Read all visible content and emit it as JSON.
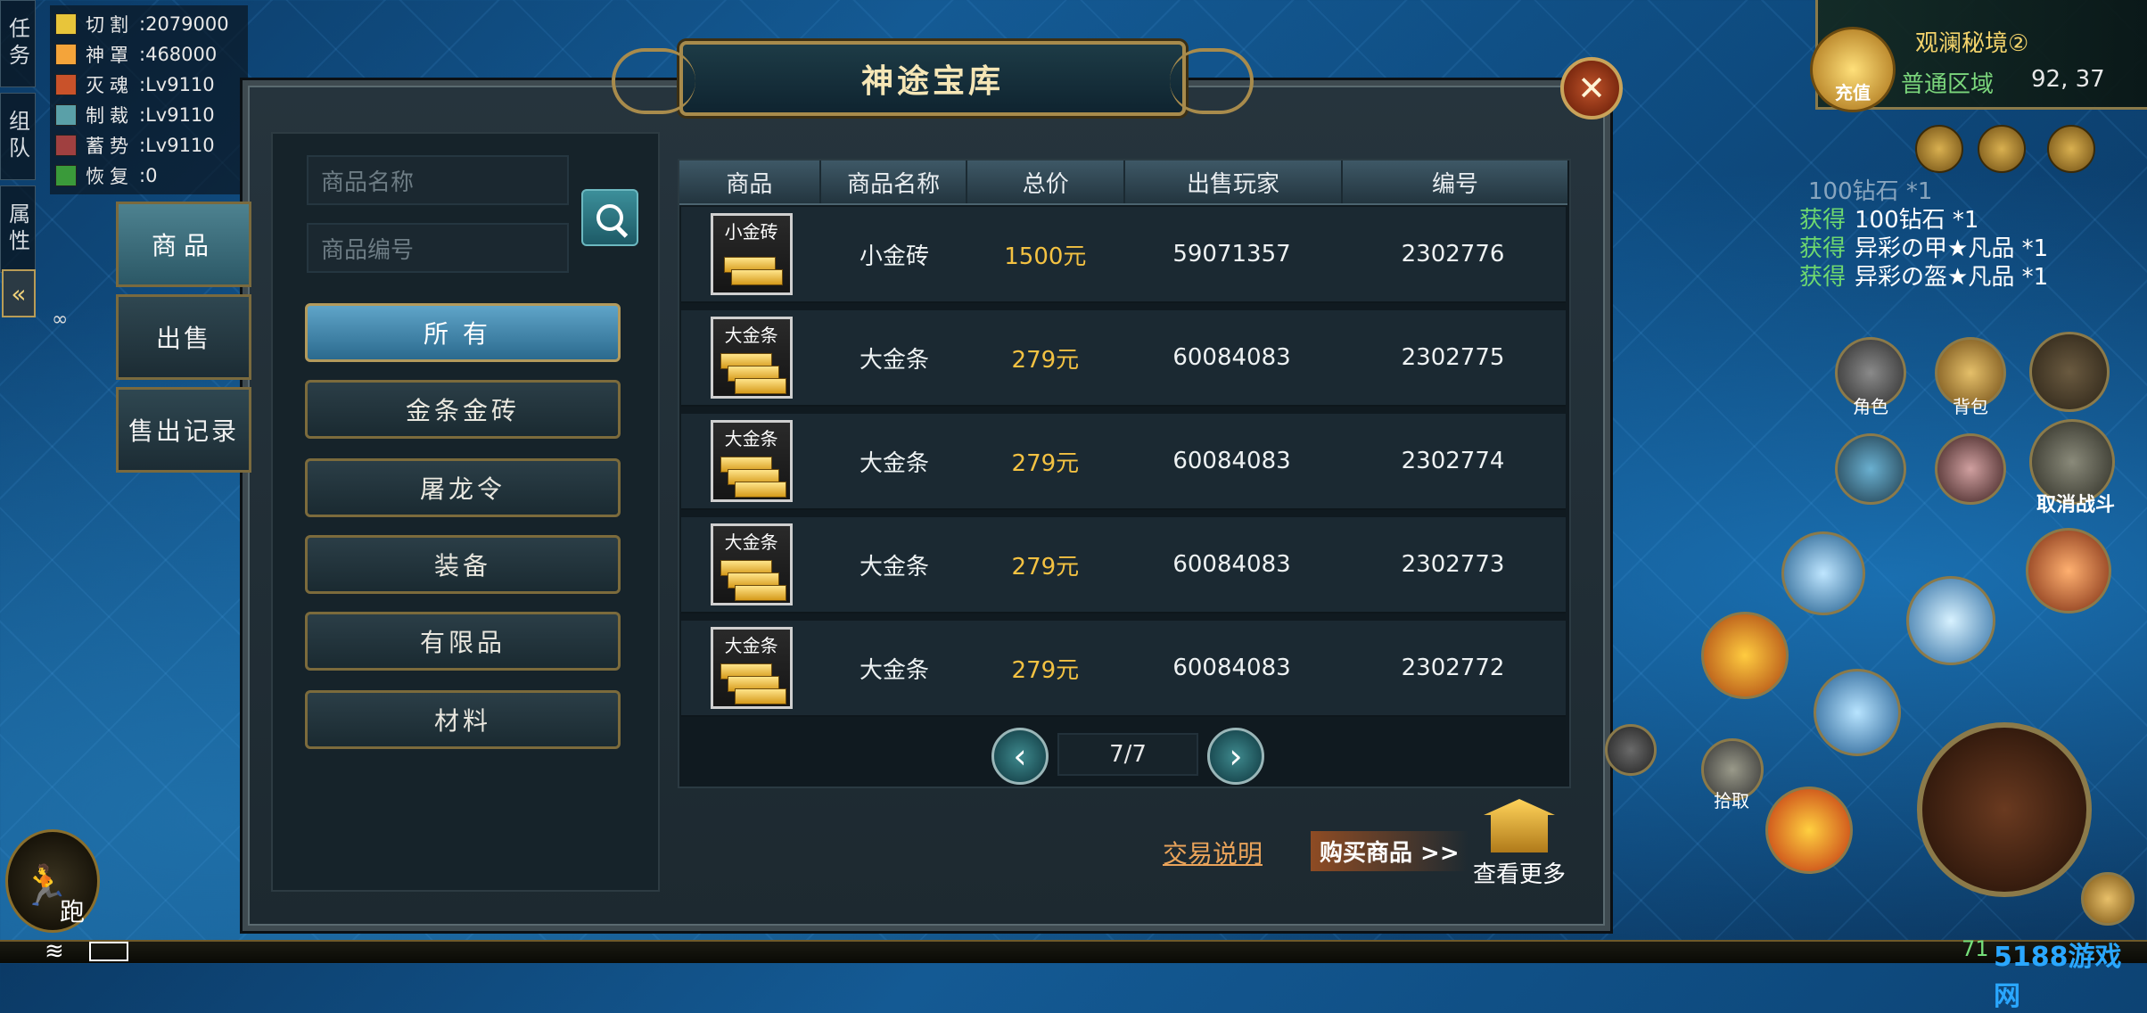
{
  "hud_left": {
    "tabs": [
      "任务",
      "组队",
      "属性"
    ],
    "stats": [
      {
        "name": "切割",
        "value": "2079000",
        "color": "#e8c53a"
      },
      {
        "name": "神罩",
        "value": "468000",
        "color": "#f4a43a"
      },
      {
        "name": "灭魂",
        "value": "Lv9110",
        "color": "#c9522a"
      },
      {
        "name": "制裁",
        "value": "Lv9110",
        "color": "#5aa0a8"
      },
      {
        "name": "蓄势",
        "value": "Lv9110",
        "color": "#a04040"
      },
      {
        "name": "恢复",
        "value": "0",
        "color": "#3a9a3a"
      }
    ],
    "run_label": "跑",
    "coord_small": "∞"
  },
  "dialog": {
    "title": "神途宝库",
    "side_tabs": [
      "商品",
      "出售",
      "售出记录"
    ],
    "search": {
      "name_placeholder": "商品名称",
      "id_placeholder": "商品编号"
    },
    "categories": [
      "所有",
      "金条金砖",
      "屠龙令",
      "装备",
      "有限品",
      "材料"
    ],
    "table": {
      "headers": [
        "商品",
        "商品名称",
        "总价",
        "出售玩家",
        "编号"
      ],
      "rows": [
        {
          "icon_label": "小金砖",
          "name": "小金砖",
          "price": "1500元",
          "seller": "59071357",
          "id": "2302776"
        },
        {
          "icon_label": "大金条",
          "name": "大金条",
          "price": "279元",
          "seller": "60084083",
          "id": "2302775"
        },
        {
          "icon_label": "大金条",
          "name": "大金条",
          "price": "279元",
          "seller": "60084083",
          "id": "2302774"
        },
        {
          "icon_label": "大金条",
          "name": "大金条",
          "price": "279元",
          "seller": "60084083",
          "id": "2302773"
        },
        {
          "icon_label": "大金条",
          "name": "大金条",
          "price": "279元",
          "seller": "60084083",
          "id": "2302772"
        }
      ]
    },
    "pager": {
      "text": "7/7"
    },
    "help_label": "交易说明",
    "buy_label": "购买商品 >>",
    "more_label": "查看更多"
  },
  "hud_right": {
    "map_name": "观澜秘境②",
    "zone": "普通区域",
    "coords": "92, 37",
    "recharge_label": "充值",
    "loot": [
      {
        "prefix": "",
        "text": "100钻石 *1",
        "dim": true
      },
      {
        "prefix": "获得",
        "text": "100钻石 *1",
        "dim": false
      },
      {
        "prefix": "获得",
        "text": "异彩の甲★凡品 *1",
        "dim": false
      },
      {
        "prefix": "获得",
        "text": "异彩の盔★凡品 *1",
        "dim": false
      }
    ],
    "buttons": {
      "role": "角色",
      "bag": "背包",
      "cancel_fight": "取消战斗",
      "pickup": "拾取"
    },
    "level": "71",
    "watermark": "5188游戏网"
  }
}
